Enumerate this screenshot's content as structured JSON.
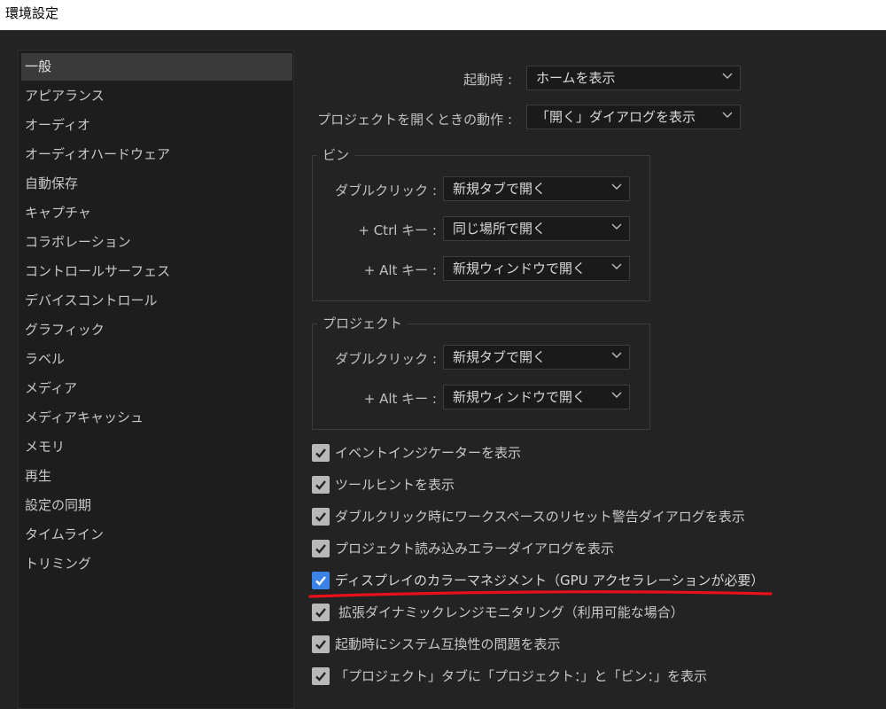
{
  "window": {
    "title": "環境設定"
  },
  "sidebar": {
    "items": [
      {
        "label": "一般"
      },
      {
        "label": "アピアランス"
      },
      {
        "label": "オーディオ"
      },
      {
        "label": "オーディオハードウェア"
      },
      {
        "label": "自動保存"
      },
      {
        "label": "キャプチャ"
      },
      {
        "label": "コラボレーション"
      },
      {
        "label": "コントロールサーフェス"
      },
      {
        "label": "デバイスコントロール"
      },
      {
        "label": "グラフィック"
      },
      {
        "label": "ラベル"
      },
      {
        "label": "メディア"
      },
      {
        "label": "メディアキャッシュ"
      },
      {
        "label": "メモリ"
      },
      {
        "label": "再生"
      },
      {
        "label": "設定の同期"
      },
      {
        "label": "タイムライン"
      },
      {
        "label": "トリミング"
      }
    ],
    "selected_index": 0
  },
  "general": {
    "startup": {
      "label": "起動時 :",
      "value": "ホームを表示"
    },
    "open_project": {
      "label": "プロジェクトを開くときの動作 :",
      "value": "「開く」ダイアログを表示"
    },
    "bins": {
      "title": "ビン",
      "double_click": {
        "label": "ダブルクリック :",
        "value": "新規タブで開く"
      },
      "ctrl": {
        "label": "+ Ctrl キー :",
        "value": "同じ場所で開く"
      },
      "alt": {
        "label": "+ Alt キー :",
        "value": "新規ウィンドウで開く"
      }
    },
    "project": {
      "title": "プロジェクト",
      "double_click": {
        "label": "ダブルクリック :",
        "value": "新規タブで開く"
      },
      "alt": {
        "label": "+ Alt キー :",
        "value": "新規ウィンドウで開く"
      }
    },
    "checkboxes": [
      {
        "label": "イベントインジケーターを表示",
        "checked": true
      },
      {
        "label": "ツールヒントを表示",
        "checked": true
      },
      {
        "label": "ダブルクリック時にワークスペースのリセット警告ダイアログを表示",
        "checked": true
      },
      {
        "label": "プロジェクト読み込みエラーダイアログを表示",
        "checked": true
      },
      {
        "label": "ディスプレイのカラーマネジメント（GPU アクセラレーションが必要）",
        "checked": true,
        "highlighted": true
      },
      {
        "label": "拡張ダイナミックレンジモニタリング（利用可能な場合）",
        "checked": true
      },
      {
        "label": "起動時にシステム互換性の問題を表示",
        "checked": true
      },
      {
        "label": "「プロジェクト」タブに「プロジェクト：」と「ビン：」を表示",
        "checked": true
      }
    ]
  },
  "colors": {
    "background": "#232323",
    "checkbox_gray": "#b8b8b8",
    "checkbox_blue": "#3b82e6",
    "annotation_red": "#e8101a"
  }
}
